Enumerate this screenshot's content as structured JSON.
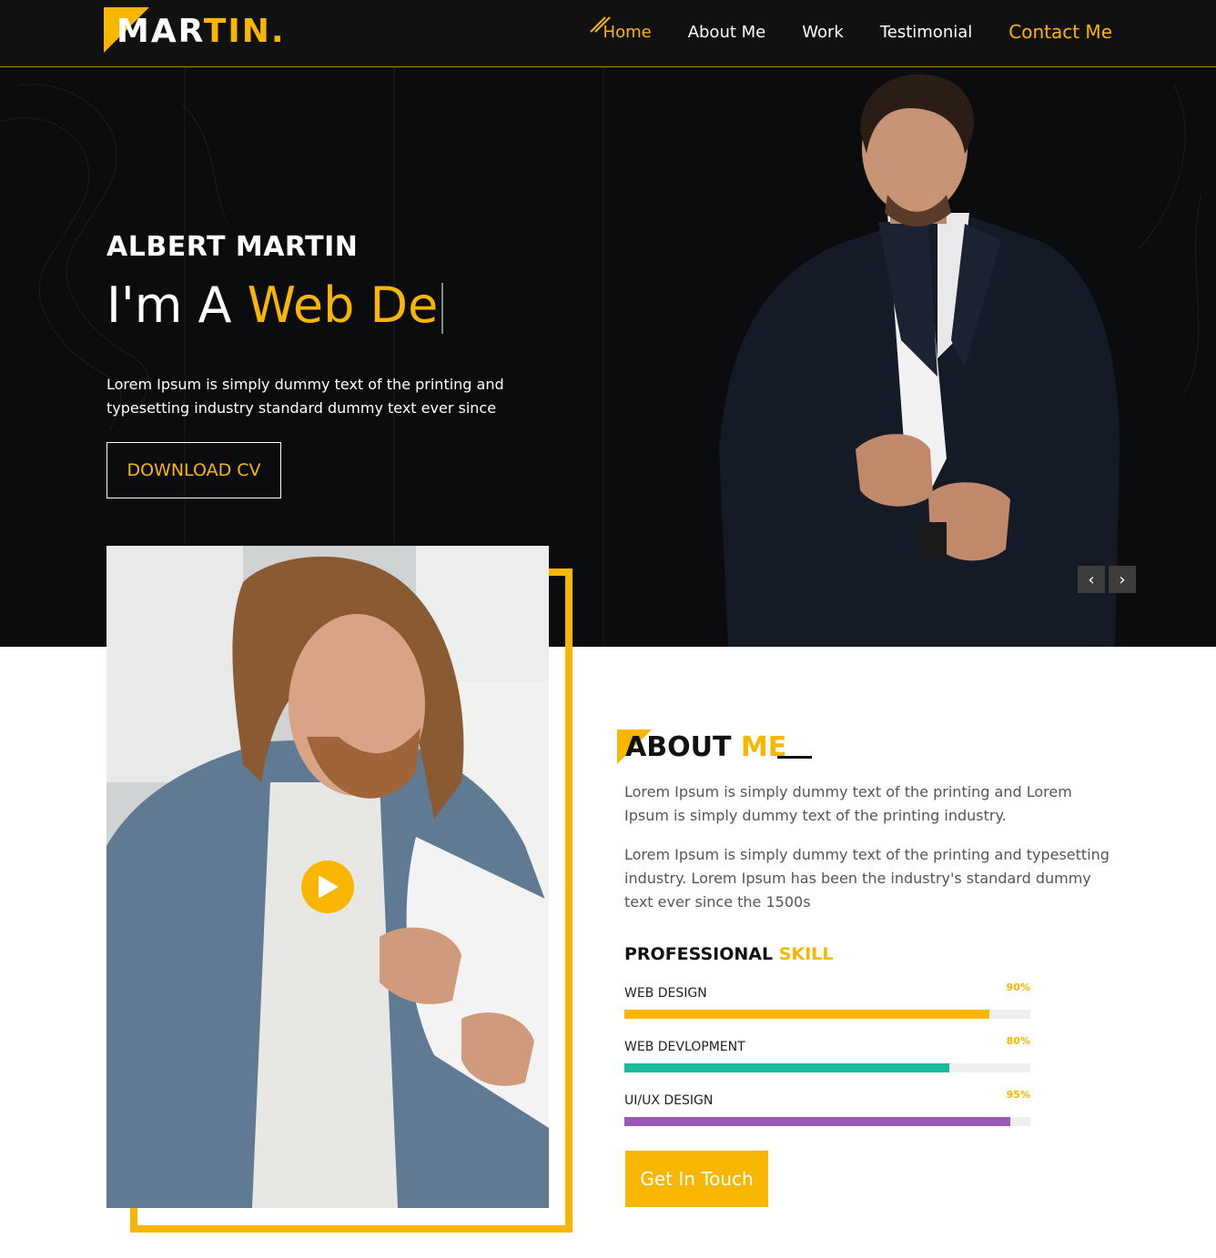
{
  "header": {
    "logo_main": "MAR",
    "logo_accent": "TIN.",
    "nav": [
      {
        "label": "Home"
      },
      {
        "label": "About Me"
      },
      {
        "label": "Work"
      },
      {
        "label": "Testimonial"
      },
      {
        "label": "Contact Me"
      }
    ]
  },
  "hero": {
    "name": "ALBERT MARTIN",
    "role_prefix": "I'm A ",
    "role_typed": "Web De",
    "description": "Lorem Ipsum is simply dummy text of the printing and typesetting industry standard dummy text ever since",
    "cta_label": "DOWNLOAD CV",
    "carousel_prev": "‹",
    "carousel_next": "›"
  },
  "about": {
    "title_main": "ABOUT ",
    "title_accent": "ME",
    "paragraph1": "Lorem Ipsum is simply dummy text of the printing and Lorem Ipsum is simply dummy text of the printing industry.",
    "paragraph2": "Lorem Ipsum is simply dummy text of the printing and typesetting industry. Lorem Ipsum has been the industry's standard dummy text ever since the 1500s",
    "skills_title_main": "PROFESSIONAL ",
    "skills_title_accent": "SKILL",
    "skills": [
      {
        "label": "WEB DESIGN",
        "percent_text": "90%",
        "value": 90,
        "color": "#f9b600"
      },
      {
        "label": "WEB DEVLOPMENT",
        "percent_text": "80%",
        "value": 80,
        "color": "#1abc9c"
      },
      {
        "label": "UI/UX DESIGN",
        "percent_text": "95%",
        "value": 95,
        "color": "#9b59b6"
      }
    ],
    "cta_label": "Get In Touch"
  },
  "colors": {
    "accent": "#f9b600",
    "dark": "#111111"
  },
  "icons": {
    "play": "play-icon",
    "nav_active": "slash-icon"
  }
}
